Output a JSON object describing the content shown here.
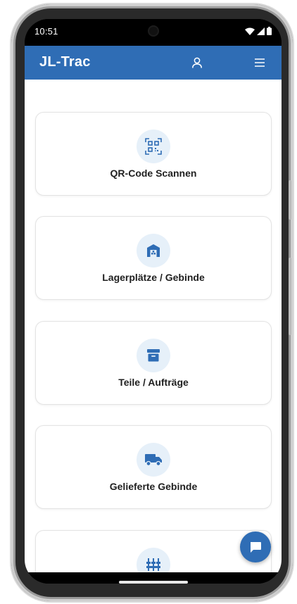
{
  "status_bar": {
    "time": "10:51",
    "icons": [
      "wifi-icon",
      "signal-icon",
      "battery-icon"
    ]
  },
  "app_bar": {
    "title": "JL-Trac",
    "icons": [
      "user-icon",
      "menu-icon"
    ]
  },
  "cards": [
    {
      "label": "QR-Code Scannen",
      "icon": "qr-code-icon"
    },
    {
      "label": "Lagerplätze / Gebinde",
      "icon": "warehouse-icon"
    },
    {
      "label": "Teile / Aufträge",
      "icon": "archive-box-icon"
    },
    {
      "label": "Gelieferte Gebinde",
      "icon": "truck-icon"
    },
    {
      "label": "",
      "icon": "sliders-icon"
    }
  ],
  "fab": {
    "icon": "chat-icon"
  },
  "colors": {
    "primary": "#2f6db5",
    "icon_circle": "#e6f0f9",
    "card_border": "#e3e3e3",
    "text": "#1f1f1f"
  }
}
